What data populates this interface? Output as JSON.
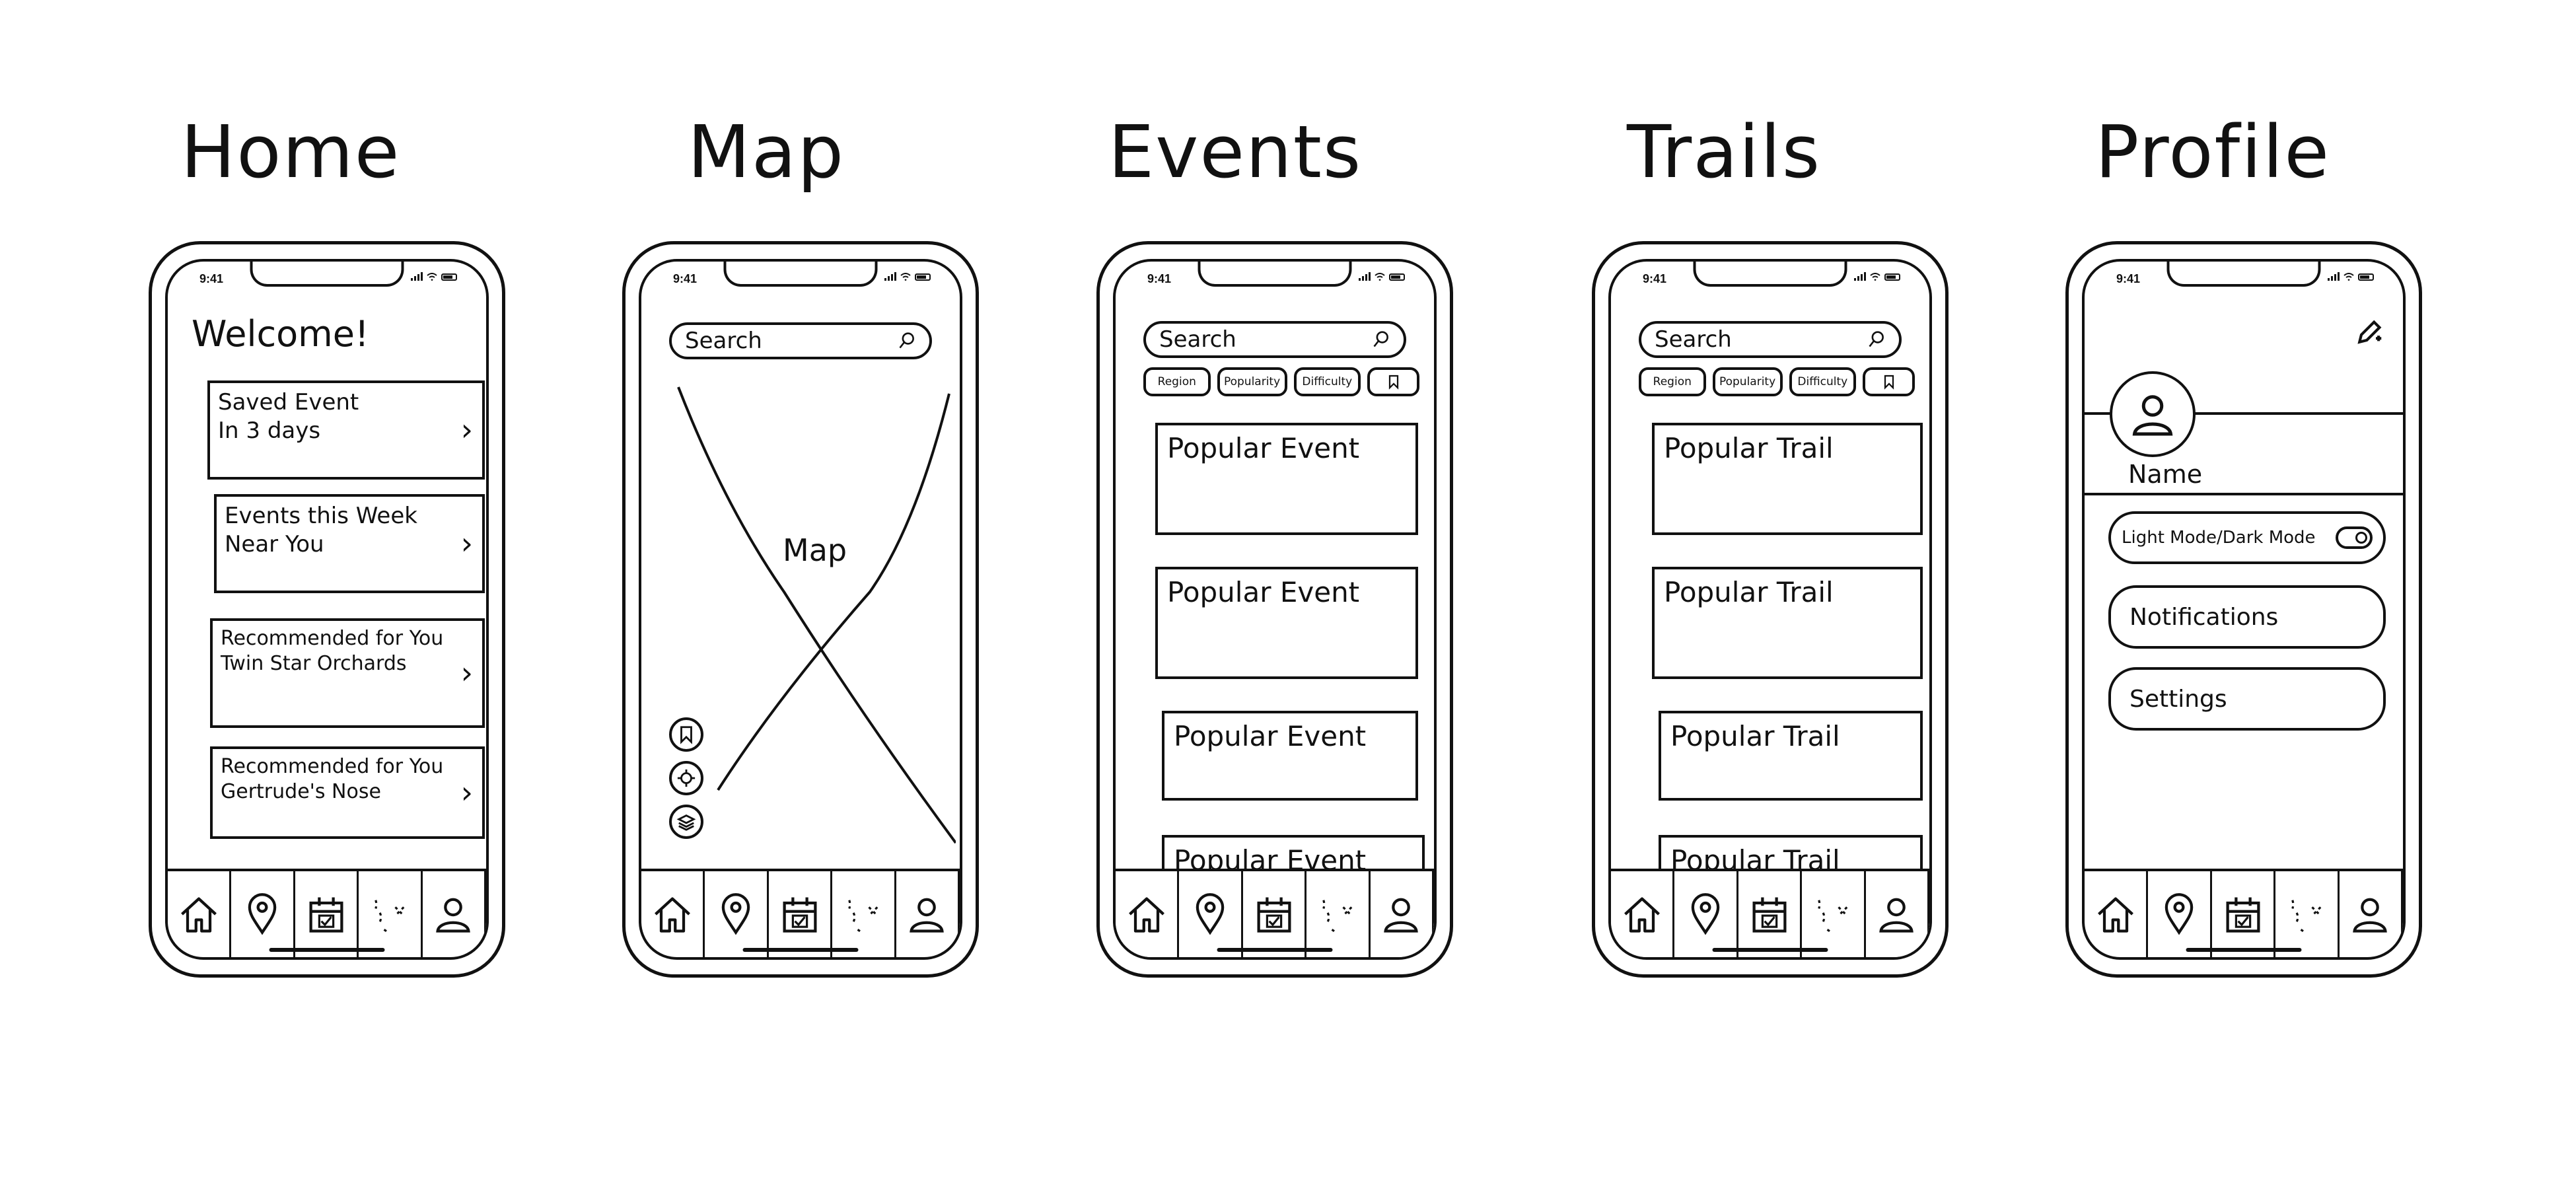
{
  "screens": {
    "home": {
      "title": "Home",
      "time": "9:41",
      "welcome": "Welcome!",
      "cards": [
        {
          "line1": "Saved Event",
          "line2": "In 3 days"
        },
        {
          "line1": "Events this Week",
          "line2": "Near You"
        },
        {
          "line1": "Recommended for You",
          "line2": "Twin Star Orchards"
        },
        {
          "line1": "Recommended for You",
          "line2": "Gertrude's Nose"
        }
      ]
    },
    "map": {
      "title": "Map",
      "time": "9:41",
      "search_placeholder": "Search",
      "map_label": "Map"
    },
    "events": {
      "title": "Events",
      "time": "9:41",
      "search_placeholder": "Search",
      "filters": [
        "Region",
        "Popularity",
        "Difficulty"
      ],
      "items": [
        "Popular Event",
        "Popular Event",
        "Popular Event",
        "Popular Event"
      ]
    },
    "trails": {
      "title": "Trails",
      "time": "9:41",
      "search_placeholder": "Search",
      "filters": [
        "Region",
        "Popularity",
        "Difficulty"
      ],
      "items": [
        "Popular Trail",
        "Popular Trail",
        "Popular Trail",
        "Popular Trail"
      ]
    },
    "profile": {
      "title": "Profile",
      "time": "9:41",
      "name": "Name",
      "options": [
        "Light Mode/Dark Mode",
        "Notifications",
        "Settings"
      ]
    }
  },
  "tab_icons": [
    "home-icon",
    "map-pin-icon",
    "calendar-icon",
    "trail-icon",
    "profile-icon"
  ]
}
